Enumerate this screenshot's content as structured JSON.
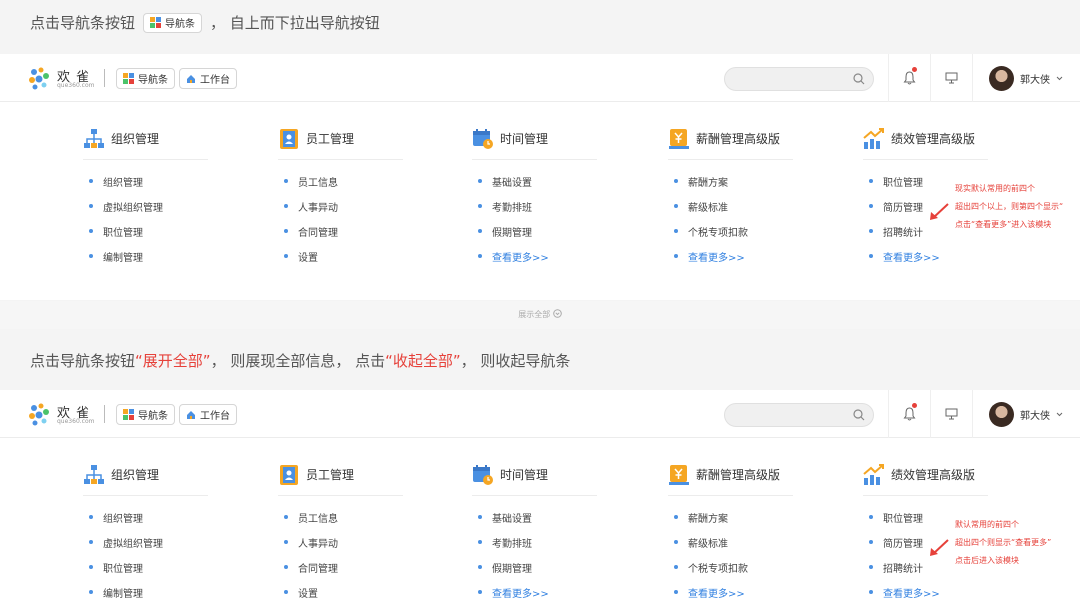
{
  "caption1": {
    "text": "点击导航条按钮",
    "chip": "导航条",
    "rest": "，  自上而下拉出导航按钮"
  },
  "caption2": {
    "pre": "点击导航条按钮 ",
    "red1": "“展开全部”",
    "mid": "， 则展现全部信息， 点击",
    "red2": "“收起全部”",
    "post": "， 则收起导航条"
  },
  "header": {
    "logo_text": "欢雀",
    "logo_sub": "que360.com",
    "nav_btn": "导航条",
    "workbench_btn": "工作台",
    "user_name": "郭大侠"
  },
  "columns": [
    {
      "title": "组织管理",
      "icon": "org-icon",
      "items": [
        "组织管理",
        "虚拟组织管理",
        "职位管理",
        "编制管理"
      ]
    },
    {
      "title": "员工管理",
      "icon": "employee-icon",
      "items": [
        "员工信息",
        "人事异动",
        "合同管理",
        "设置"
      ]
    },
    {
      "title": "时间管理",
      "icon": "calendar-icon",
      "items": [
        "基础设置",
        "考勤排班",
        "假期管理",
        "查看更多>>"
      ]
    },
    {
      "title": "薪酬管理高级版",
      "icon": "salary-icon",
      "items": [
        "薪酬方案",
        "薪级标准",
        "个税专项扣款",
        "查看更多>>"
      ]
    },
    {
      "title": "绩效管理高级版",
      "icon": "performance-icon",
      "items": [
        "职位管理",
        "简历管理",
        "招聘统计",
        "查看更多>>"
      ]
    }
  ],
  "note1": [
    "现实默认常用的前四个",
    "超出四个以上，则第四个显示“",
    "点击“查看更多”进入该模块"
  ],
  "note2": [
    "默认常用的前四个",
    "超出四个则显示“查看更多”",
    "点击后进入该模块"
  ],
  "expand_label": "展示全部",
  "colors": {
    "accent": "#4a90e2",
    "red": "#e6413a",
    "link": "#2f7fe0"
  }
}
